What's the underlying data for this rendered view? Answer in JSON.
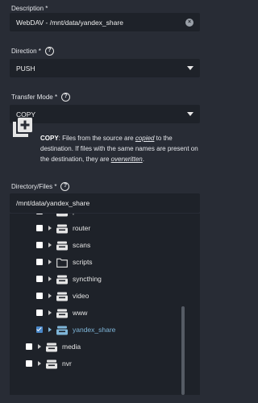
{
  "description": {
    "label": "Description *",
    "value": "WebDAV - /mnt/data/yandex_share"
  },
  "direction": {
    "label": "Direction *",
    "value": "PUSH"
  },
  "transfer_mode": {
    "label": "Transfer Mode *",
    "value": "COPY",
    "desc_title": "COPY",
    "desc_1": ": Files from the source are ",
    "desc_copied": "copied",
    "desc_2": " to the destination. If files with the same names are present on the destination, they are ",
    "desc_overwritten": "overwritten",
    "desc_3": "."
  },
  "directory": {
    "label": "Directory/Files *",
    "value": "/mnt/data/yandex_share",
    "items": [
      {
        "name": "pve",
        "checked": false,
        "selected": false,
        "icon": "dataset-icon"
      },
      {
        "name": "router",
        "checked": false,
        "selected": false,
        "icon": "dataset-icon"
      },
      {
        "name": "scans",
        "checked": false,
        "selected": false,
        "icon": "dataset-icon"
      },
      {
        "name": "scripts",
        "checked": false,
        "selected": false,
        "icon": "folder-icon"
      },
      {
        "name": "syncthing",
        "checked": false,
        "selected": false,
        "icon": "dataset-icon"
      },
      {
        "name": "video",
        "checked": false,
        "selected": false,
        "icon": "dataset-icon"
      },
      {
        "name": "www",
        "checked": false,
        "selected": false,
        "icon": "dataset-icon"
      },
      {
        "name": "yandex_share",
        "checked": true,
        "selected": true,
        "icon": "dataset-icon"
      },
      {
        "name": "media",
        "checked": false,
        "selected": false,
        "icon": "dataset-icon"
      },
      {
        "name": "nvr",
        "checked": false,
        "selected": false,
        "icon": "dataset-icon"
      }
    ]
  },
  "colors": {
    "background": "#282c35",
    "field": "#1e2229",
    "accent": "#4a88c9",
    "selected_text": "#7fb6d9"
  }
}
